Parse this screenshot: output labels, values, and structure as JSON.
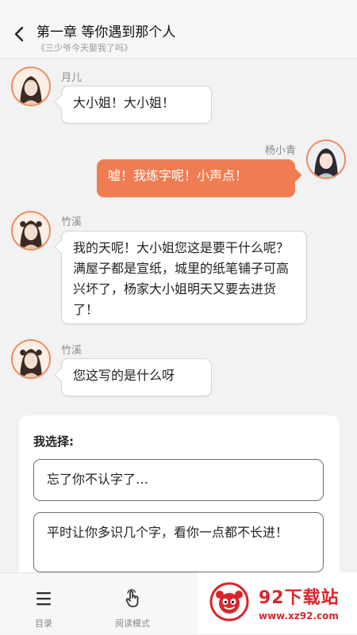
{
  "header": {
    "title": "第一章 等你遇到那个人",
    "subtitle": "《三少爷今天娶我了吗》"
  },
  "messages": [
    {
      "speaker": "月儿",
      "side": "left",
      "text": "大小姐！大小姐！"
    },
    {
      "speaker": "杨小青",
      "side": "right",
      "text": "嘘！我练字呢！小声点！"
    },
    {
      "speaker": "竹溪",
      "side": "left",
      "text": "我的天呢！大小姐您这是要干什么呢？满屋子都是宣纸，城里的纸笔铺子可高兴坏了，杨家大小姐明天又要去进货了！"
    },
    {
      "speaker": "竹溪",
      "side": "left",
      "text": "您这写的是什么呀"
    }
  ],
  "choice": {
    "title": "我选择:",
    "options": [
      "忘了你不认字了…",
      "平时让你多识几个字，看你一点都不长进！"
    ]
  },
  "bottom_nav": [
    {
      "label": "目录",
      "icon": "list-icon"
    },
    {
      "label": "阅读模式",
      "icon": "tap-hand-icon"
    }
  ],
  "watermark": {
    "name": "92下载站",
    "url": "www.xz92.com"
  },
  "colors": {
    "accent": "#f07d52",
    "avatar_border": "#ef8a5e",
    "watermark_red": "#d8262c"
  }
}
